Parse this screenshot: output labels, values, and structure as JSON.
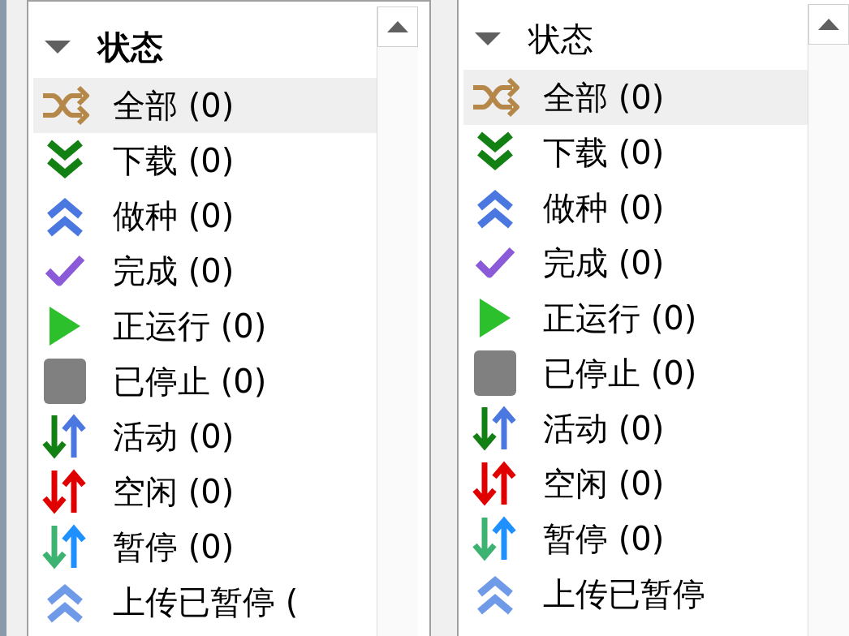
{
  "panels": [
    {
      "header": "状态",
      "expanded": true,
      "items": [
        {
          "kind": "all",
          "label": "全部 (0)",
          "selected": true
        },
        {
          "kind": "downloading",
          "label": "下载 (0)",
          "selected": false
        },
        {
          "kind": "seeding",
          "label": "做种 (0)",
          "selected": false
        },
        {
          "kind": "completed",
          "label": "完成 (0)",
          "selected": false
        },
        {
          "kind": "running",
          "label": "正运行 (0)",
          "selected": false
        },
        {
          "kind": "stopped",
          "label": "已停止 (0)",
          "selected": false
        },
        {
          "kind": "active",
          "label": "活动 (0)",
          "selected": false
        },
        {
          "kind": "inactive",
          "label": "空闲 (0)",
          "selected": false
        },
        {
          "kind": "paused",
          "label": "暂停 (0)",
          "selected": false
        },
        {
          "kind": "upload-paused",
          "label": "上传已暂停 (",
          "selected": false
        }
      ]
    },
    {
      "header": "状态",
      "expanded": true,
      "items": [
        {
          "kind": "all",
          "label": "全部 (0)",
          "selected": true
        },
        {
          "kind": "downloading",
          "label": "下载 (0)",
          "selected": false
        },
        {
          "kind": "seeding",
          "label": "做种 (0)",
          "selected": false
        },
        {
          "kind": "completed",
          "label": "完成 (0)",
          "selected": false
        },
        {
          "kind": "running",
          "label": "正运行 (0)",
          "selected": false
        },
        {
          "kind": "stopped",
          "label": "已停止 (0)",
          "selected": false
        },
        {
          "kind": "active",
          "label": "活动 (0)",
          "selected": false
        },
        {
          "kind": "inactive",
          "label": "空闲 (0)",
          "selected": false
        },
        {
          "kind": "paused",
          "label": "暂停 (0)",
          "selected": false
        },
        {
          "kind": "upload-paused",
          "label": "上传已暂停",
          "selected": false
        }
      ]
    }
  ]
}
